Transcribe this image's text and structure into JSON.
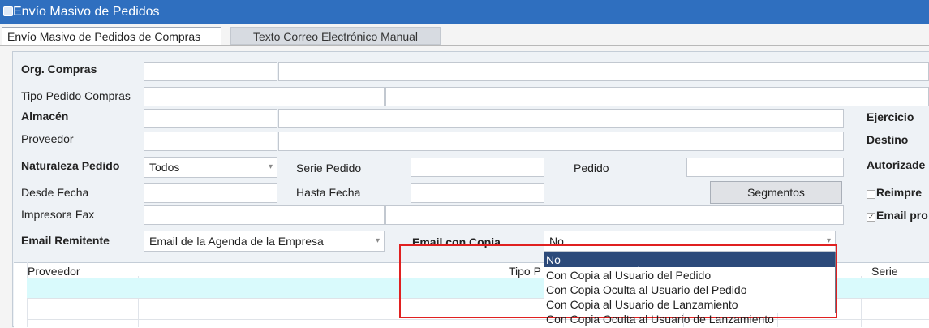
{
  "window": {
    "title": "Envío Masivo de Pedidos"
  },
  "tabs": [
    {
      "label": "Envío Masivo de Pedidos de Compras"
    },
    {
      "label": "Texto Correo Electrónico Manual"
    }
  ],
  "form": {
    "org_compras_label": "Org. Compras",
    "tipo_pedido_label": "Tipo Pedido Compras",
    "almacen_label": "Almacén",
    "proveedor_label": "Proveedor",
    "naturaleza_label": "Naturaleza Pedido",
    "naturaleza_value": "Todos",
    "serie_label": "Serie Pedido",
    "pedido_label": "Pedido",
    "desde_label": "Desde Fecha",
    "hasta_label": "Hasta Fecha",
    "segmentos_button": "Segmentos",
    "impresora_label": "Impresora Fax",
    "email_remitente_label": "Email Remitente",
    "email_remitente_value": "Email de la Agenda de la Empresa",
    "email_copia_label": "Email con Copia",
    "right_ejercicio": "Ejercicio",
    "right_destino": "Destino",
    "right_autorizado": "Autorizade",
    "right_reimpre": "Reimpre",
    "right_email_pro": "Email pro"
  },
  "email_copia_options": [
    "No",
    "Con Copia al Usuario del Pedido",
    "Con Copia Oculta al Usuario del Pedido",
    "Con Copia al Usuario de Lanzamiento",
    "Con Copia Oculta al Usuario de Lanzamiento"
  ],
  "email_copia_selected": "No",
  "grid": {
    "col_proveedor": "Proveedor",
    "col_tipo": "Tipo P",
    "col_serie": "Serie"
  }
}
